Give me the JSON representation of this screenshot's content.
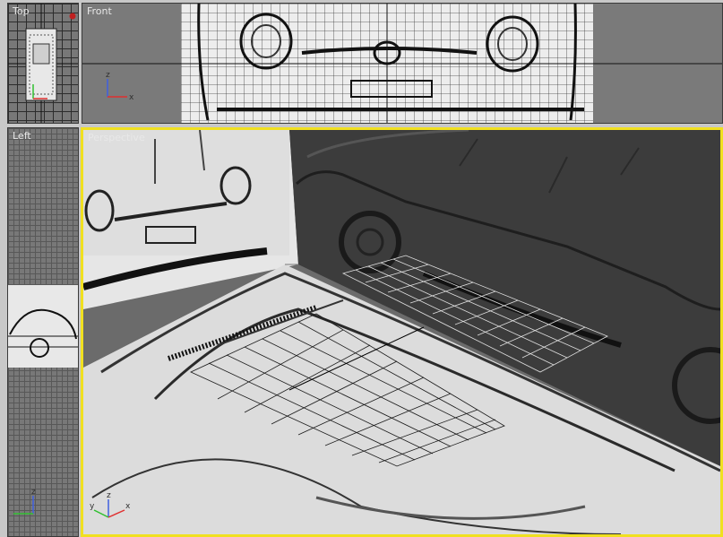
{
  "viewports": {
    "top": {
      "label": "Top"
    },
    "front": {
      "label": "Front"
    },
    "left": {
      "label": "Left"
    },
    "persp": {
      "label": "Perspective"
    }
  },
  "colors": {
    "active_border": "#f0e020",
    "viewport_bg": "#787878",
    "axis_x": "#e03030",
    "axis_y": "#30c030",
    "axis_z": "#4040e0"
  },
  "axis": {
    "x": "x",
    "y": "y",
    "z": "z"
  },
  "icons": [
    "axis-tripod-icon",
    "red-marker-icon"
  ]
}
